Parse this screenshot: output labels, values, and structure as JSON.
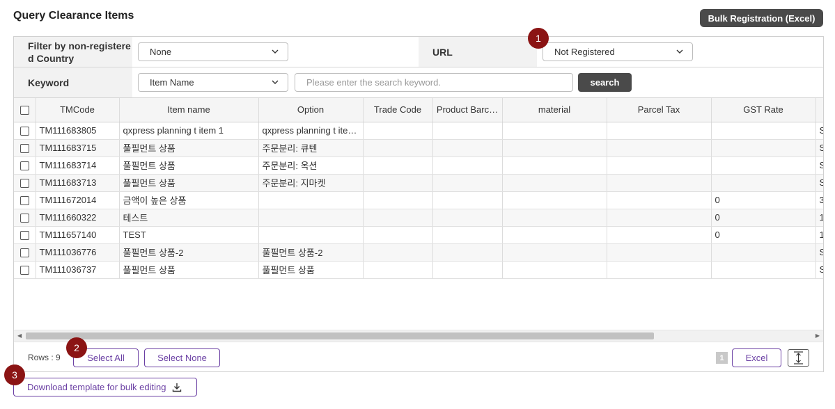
{
  "page": {
    "title": "Query Clearance Items",
    "bulk_registration_label": "Bulk Registration (Excel)"
  },
  "filters": {
    "country_label": "Filter by non-registere\nd Country",
    "country_value": "None",
    "url_label": "URL",
    "url_value": "Not Registered",
    "keyword_label": "Keyword",
    "keyword_field_value": "Item Name",
    "keyword_placeholder": "Please enter the search keyword.",
    "search_label": "search"
  },
  "table": {
    "columns": [
      "TMCode",
      "Item name",
      "Option",
      "Trade Code",
      "Product Barc…",
      "material",
      "Parcel Tax",
      "GST Rate"
    ],
    "rows": [
      {
        "tmcode": "TM111683805",
        "item": "qxpress planning t item 1",
        "option": "qxpress planning t ite…",
        "gst": "",
        "extra": "S"
      },
      {
        "tmcode": "TM111683715",
        "item": "풀필먼트 상품",
        "option": "주문분리: 큐텐",
        "gst": "",
        "extra": "S"
      },
      {
        "tmcode": "TM111683714",
        "item": "풀필먼트 상품",
        "option": "주문분리: 옥션",
        "gst": "",
        "extra": "S"
      },
      {
        "tmcode": "TM111683713",
        "item": "풀필먼트 상품",
        "option": "주문분리: 지마켓",
        "gst": "",
        "extra": "S"
      },
      {
        "tmcode": "TM111672014",
        "item": "금액이 높은 상품",
        "option": "",
        "gst": "0",
        "extra": "3"
      },
      {
        "tmcode": "TM111660322",
        "item": "테스트",
        "option": "",
        "gst": "0",
        "extra": "1"
      },
      {
        "tmcode": "TM111657140",
        "item": "TEST",
        "option": "",
        "gst": "0",
        "extra": "1"
      },
      {
        "tmcode": "TM111036776",
        "item": "풀필먼트 상품-2",
        "option": "풀필먼트 상품-2",
        "gst": "",
        "extra": "S"
      },
      {
        "tmcode": "TM111036737",
        "item": "풀필먼트 상품",
        "option": "풀필먼트 상품",
        "gst": "",
        "extra": "S"
      }
    ]
  },
  "footer": {
    "rows_label": "Rows : 9",
    "select_all_label": "Select All",
    "select_none_label": "Select None",
    "page_number": "1",
    "excel_label": "Excel",
    "download_template_label": "Download template for bulk editing"
  },
  "markers": [
    "1",
    "2",
    "3"
  ],
  "colors": {
    "accent": "#6a3fa3",
    "marker": "#8b1414",
    "dark_button": "#4a4a4a"
  },
  "icons": [
    "chevron-down-icon",
    "download-icon",
    "expand-height-icon",
    "scroll-left-icon",
    "scroll-right-icon"
  ]
}
